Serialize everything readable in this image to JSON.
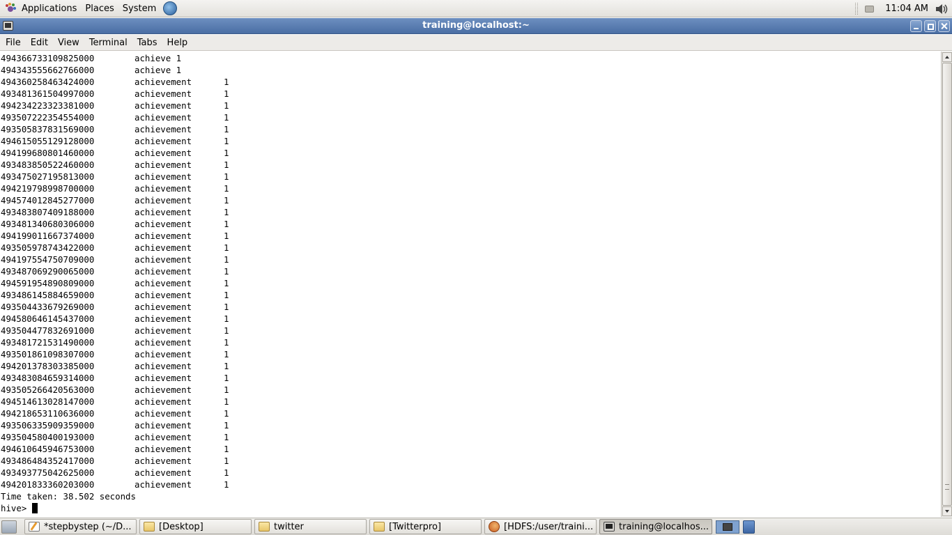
{
  "top_panel": {
    "menus": [
      "Applications",
      "Places",
      "System"
    ],
    "clock": "11:04 AM"
  },
  "window": {
    "title": "training@localhost:~",
    "menus": [
      "File",
      "Edit",
      "View",
      "Terminal",
      "Tabs",
      "Help"
    ]
  },
  "terminal": {
    "rows": [
      {
        "id": "494366733109825000",
        "word": "achieve 1",
        "count": ""
      },
      {
        "id": "494343555662766000",
        "word": "achieve 1",
        "count": ""
      },
      {
        "id": "494360258463424000",
        "word": "achievement",
        "count": "1"
      },
      {
        "id": "493481361504997000",
        "word": "achievement",
        "count": "1"
      },
      {
        "id": "494234223323381000",
        "word": "achievement",
        "count": "1"
      },
      {
        "id": "493507222354554000",
        "word": "achievement",
        "count": "1"
      },
      {
        "id": "493505837831569000",
        "word": "achievement",
        "count": "1"
      },
      {
        "id": "494615055129128000",
        "word": "achievement",
        "count": "1"
      },
      {
        "id": "494199680801460000",
        "word": "achievement",
        "count": "1"
      },
      {
        "id": "493483850522460000",
        "word": "achievement",
        "count": "1"
      },
      {
        "id": "493475027195813000",
        "word": "achievement",
        "count": "1"
      },
      {
        "id": "494219798998700000",
        "word": "achievement",
        "count": "1"
      },
      {
        "id": "494574012845277000",
        "word": "achievement",
        "count": "1"
      },
      {
        "id": "493483807409188000",
        "word": "achievement",
        "count": "1"
      },
      {
        "id": "493481340680306000",
        "word": "achievement",
        "count": "1"
      },
      {
        "id": "494199011667374000",
        "word": "achievement",
        "count": "1"
      },
      {
        "id": "493505978743422000",
        "word": "achievement",
        "count": "1"
      },
      {
        "id": "494197554750709000",
        "word": "achievement",
        "count": "1"
      },
      {
        "id": "493487069290065000",
        "word": "achievement",
        "count": "1"
      },
      {
        "id": "494591954890809000",
        "word": "achievement",
        "count": "1"
      },
      {
        "id": "493486145884659000",
        "word": "achievement",
        "count": "1"
      },
      {
        "id": "493504433679269000",
        "word": "achievement",
        "count": "1"
      },
      {
        "id": "494580646145437000",
        "word": "achievement",
        "count": "1"
      },
      {
        "id": "493504477832691000",
        "word": "achievement",
        "count": "1"
      },
      {
        "id": "493481721531490000",
        "word": "achievement",
        "count": "1"
      },
      {
        "id": "493501861098307000",
        "word": "achievement",
        "count": "1"
      },
      {
        "id": "494201378303385000",
        "word": "achievement",
        "count": "1"
      },
      {
        "id": "493483084659314000",
        "word": "achievement",
        "count": "1"
      },
      {
        "id": "493505266420563000",
        "word": "achievement",
        "count": "1"
      },
      {
        "id": "494514613028147000",
        "word": "achievement",
        "count": "1"
      },
      {
        "id": "494218653110636000",
        "word": "achievement",
        "count": "1"
      },
      {
        "id": "493506335909359000",
        "word": "achievement",
        "count": "1"
      },
      {
        "id": "493504580400193000",
        "word": "achievement",
        "count": "1"
      },
      {
        "id": "494610645946753000",
        "word": "achievement",
        "count": "1"
      },
      {
        "id": "493486484352417000",
        "word": "achievement",
        "count": "1"
      },
      {
        "id": "493493775042625000",
        "word": "achievement",
        "count": "1"
      },
      {
        "id": "494201833360203000",
        "word": "achievement",
        "count": "1"
      }
    ],
    "time_taken": "Time taken: 38.502 seconds",
    "prompt": "hive> "
  },
  "taskbar": {
    "tasks": [
      {
        "label": "*stepbystep (~/D...",
        "icon": "text-editor-icon"
      },
      {
        "label": "[Desktop]",
        "icon": "folder-icon"
      },
      {
        "label": "twitter",
        "icon": "folder-icon"
      },
      {
        "label": "[Twitterpro]",
        "icon": "folder-icon"
      },
      {
        "label": "[HDFS:/user/traini...",
        "icon": "firefox-icon"
      },
      {
        "label": "training@localhos...",
        "icon": "terminal-icon"
      }
    ]
  }
}
